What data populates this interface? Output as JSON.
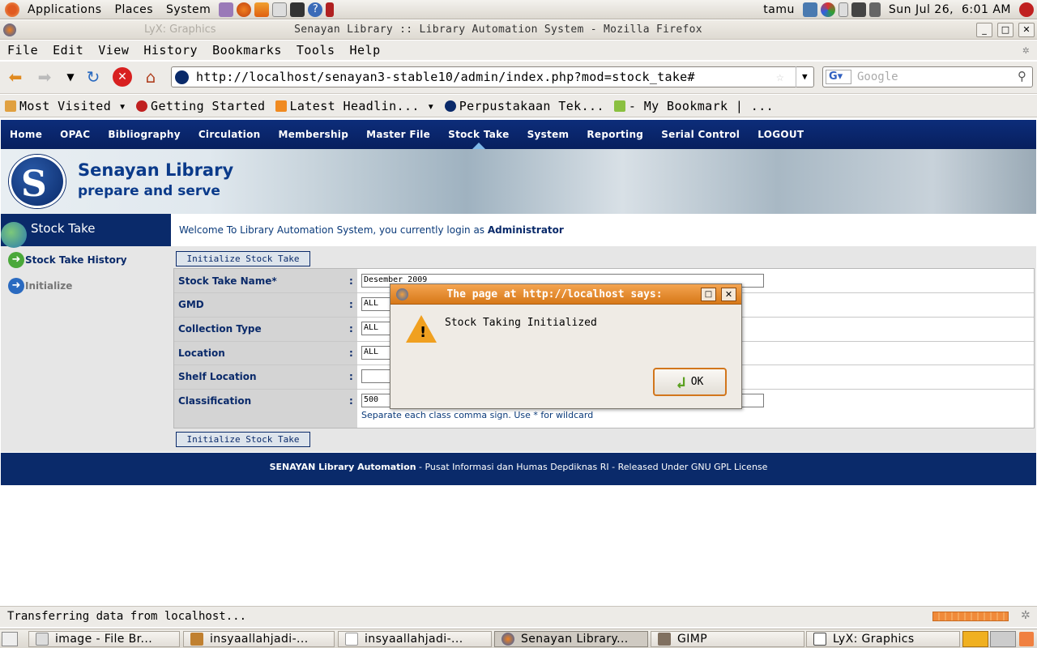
{
  "top_panel": {
    "menus": [
      "Applications",
      "Places",
      "System"
    ],
    "user": "tamu",
    "clock": "Sun Jul 26,  6:01 AM"
  },
  "window": {
    "ghost_title": "LyX: Graphics",
    "title": "Senayan Library :: Library Automation System - Mozilla Firefox"
  },
  "menubar": [
    "File",
    "Edit",
    "View",
    "History",
    "Bookmarks",
    "Tools",
    "Help"
  ],
  "toolbar": {
    "url": "http://localhost/senayan3-stable10/admin/index.php?mod=stock_take#",
    "search_placeholder": "Google"
  },
  "bookmarks": [
    "Most Visited ▾",
    "Getting Started",
    "Latest Headlin... ▾",
    "Perpustakaan Tek...",
    "- My Bookmark | ..."
  ],
  "site": {
    "nav": [
      "Home",
      "OPAC",
      "Bibliography",
      "Circulation",
      "Membership",
      "Master File",
      "Stock Take",
      "System",
      "Reporting",
      "Serial Control",
      "LOGOUT"
    ],
    "active_nav": "Stock Take",
    "name": "Senayan Library",
    "tagline": "prepare and serve",
    "sidebar_title": "Stock Take",
    "sidebar_items": [
      "Stock Take History",
      "Initialize"
    ],
    "welcome_prefix": "Welcome To Library Automation System, you currently login as ",
    "welcome_user": "Administrator",
    "init_button": "Initialize Stock Take",
    "form": {
      "stock_take_name_label": "Stock Take Name*",
      "stock_take_name_value": "Desember 2009",
      "gmd_label": "GMD",
      "gmd_value": "ALL",
      "collection_type_label": "Collection Type",
      "collection_type_value": "ALL",
      "location_label": "Location",
      "location_value": "ALL",
      "shelf_location_label": "Shelf Location",
      "shelf_location_value": "",
      "classification_label": "Classification",
      "classification_value": "500",
      "hint": "Separate each class comma sign. Use * for wildcard",
      "colon": ":"
    },
    "footer_bold": "SENAYAN Library Automation",
    "footer_rest": " - Pusat Informasi dan Humas Depdiknas RI - Released Under GNU GPL License"
  },
  "dialog": {
    "title": "The page at http://localhost says:",
    "message": "Stock Taking Initialized",
    "ok": "OK"
  },
  "statusbar": {
    "text": "Transferring data from localhost..."
  },
  "taskbar": [
    "image - File Br...",
    "insyaallahjadi-...",
    "insyaallahjadi-...",
    "Senayan Library...",
    "GIMP",
    "LyX: Graphics"
  ],
  "colors": {
    "site_blue": "#0a2a6a",
    "dialog_orange": "#e0882a"
  }
}
